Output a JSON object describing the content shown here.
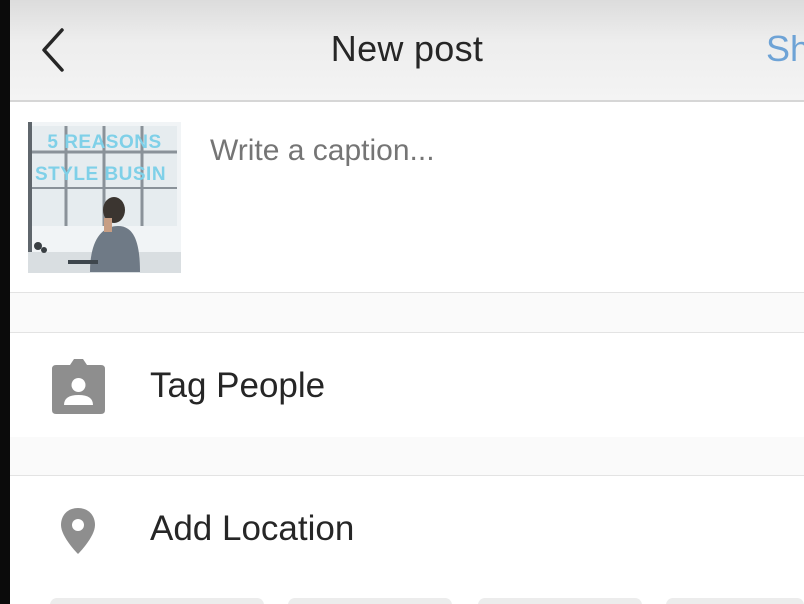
{
  "header": {
    "back_icon": "chevron-left-icon",
    "title": "New post",
    "share_label": "Sh"
  },
  "post": {
    "thumbnail_line1": "5 REASONS",
    "thumbnail_line2": "STYLE BUSIN",
    "caption_placeholder": "Write a caption..."
  },
  "options": {
    "tag_people": {
      "label": "Tag People",
      "icon": "tag-person-icon"
    },
    "add_location": {
      "label": "Add Location",
      "icon": "location-pin-icon"
    }
  },
  "colors": {
    "share_accent": "#6ea3d6",
    "text_primary": "#262626",
    "placeholder": "#a6a6a6",
    "icon_gray": "#8e8e8e"
  }
}
